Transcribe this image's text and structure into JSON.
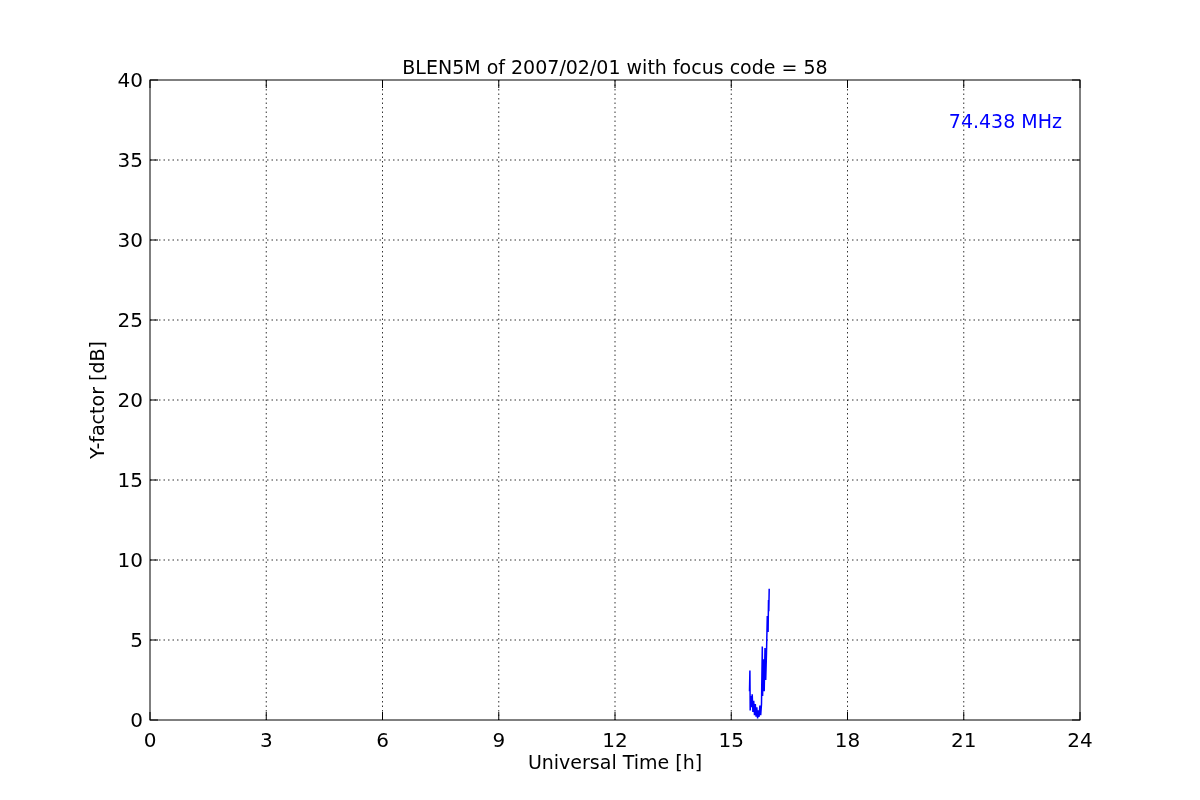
{
  "chart_data": {
    "type": "line",
    "title": "BLEN5M of 2007/02/01 with focus code = 58",
    "xlabel": "Universal Time [h]",
    "ylabel": "Y-factor [dB]",
    "xlim": [
      0,
      24
    ],
    "ylim": [
      0,
      40
    ],
    "xticks": [
      0,
      3,
      6,
      9,
      12,
      15,
      18,
      21,
      24
    ],
    "yticks": [
      0,
      5,
      10,
      15,
      20,
      25,
      30,
      35,
      40
    ],
    "x": [
      15.47,
      15.48,
      15.49,
      15.5,
      15.52,
      15.54,
      15.56,
      15.58,
      15.6,
      15.62,
      15.64,
      15.66,
      15.68,
      15.7,
      15.72,
      15.74,
      15.76,
      15.78,
      15.8,
      15.81,
      15.83,
      15.85,
      15.87,
      15.89,
      15.91,
      15.93,
      15.95,
      15.96,
      15.97,
      15.98
    ],
    "series": [
      {
        "name": "74.438 MHz",
        "color": "#0000ff",
        "values": [
          1.8,
          3.1,
          0.6,
          1.5,
          0.8,
          1.6,
          0.5,
          1.2,
          0.3,
          1.0,
          0.2,
          0.8,
          0.1,
          0.6,
          0.2,
          0.9,
          0.3,
          1.0,
          4.6,
          1.5,
          3.8,
          1.8,
          4.5,
          2.5,
          4.2,
          6.5,
          5.5,
          7.5,
          6.8,
          8.2
        ]
      }
    ],
    "grid": true
  }
}
